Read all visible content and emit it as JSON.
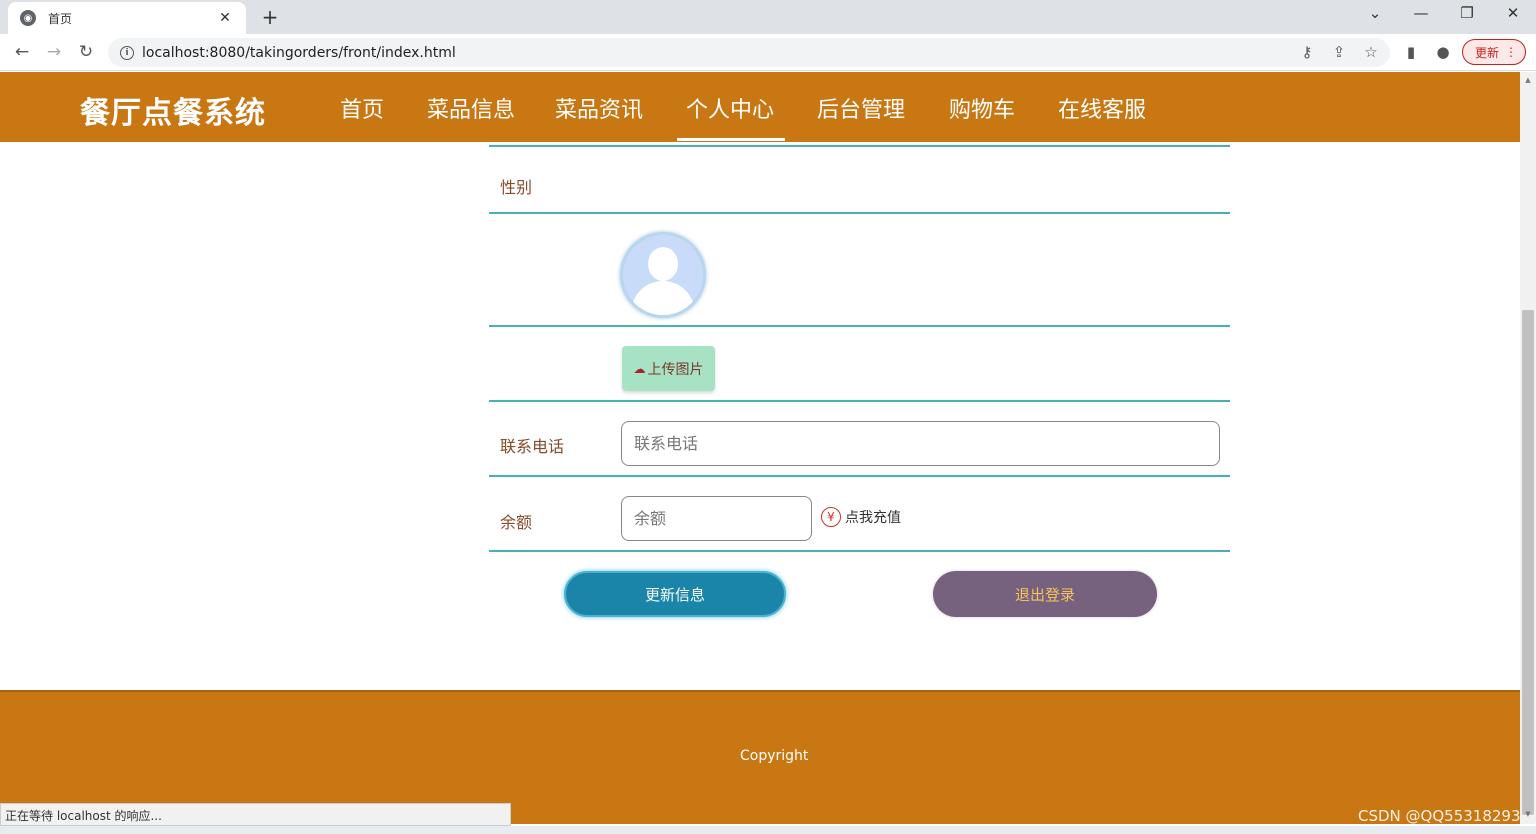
{
  "browser": {
    "tab_title": "首页",
    "url": "localhost:8080/takingorders/front/index.html",
    "update_label": "更新",
    "status_text": "正在等待 localhost 的响应..."
  },
  "site": {
    "title": "餐厅点餐系统",
    "nav": [
      "首页",
      "菜品信息",
      "菜品资讯",
      "个人中心",
      "后台管理",
      "购物车",
      "在线客服"
    ],
    "active_nav": "个人中心"
  },
  "form": {
    "gender_label": "性别",
    "upload_label": "上传图片",
    "phone_label": "联系电话",
    "phone_placeholder": "联系电话",
    "balance_label": "余额",
    "balance_placeholder": "余额",
    "recharge_icon": "¥",
    "recharge_label": "点我充值",
    "update_button": "更新信息",
    "logout_button": "退出登录"
  },
  "footer": {
    "copyright": "Copyright"
  },
  "watermark": "CSDN @QQ55318293"
}
